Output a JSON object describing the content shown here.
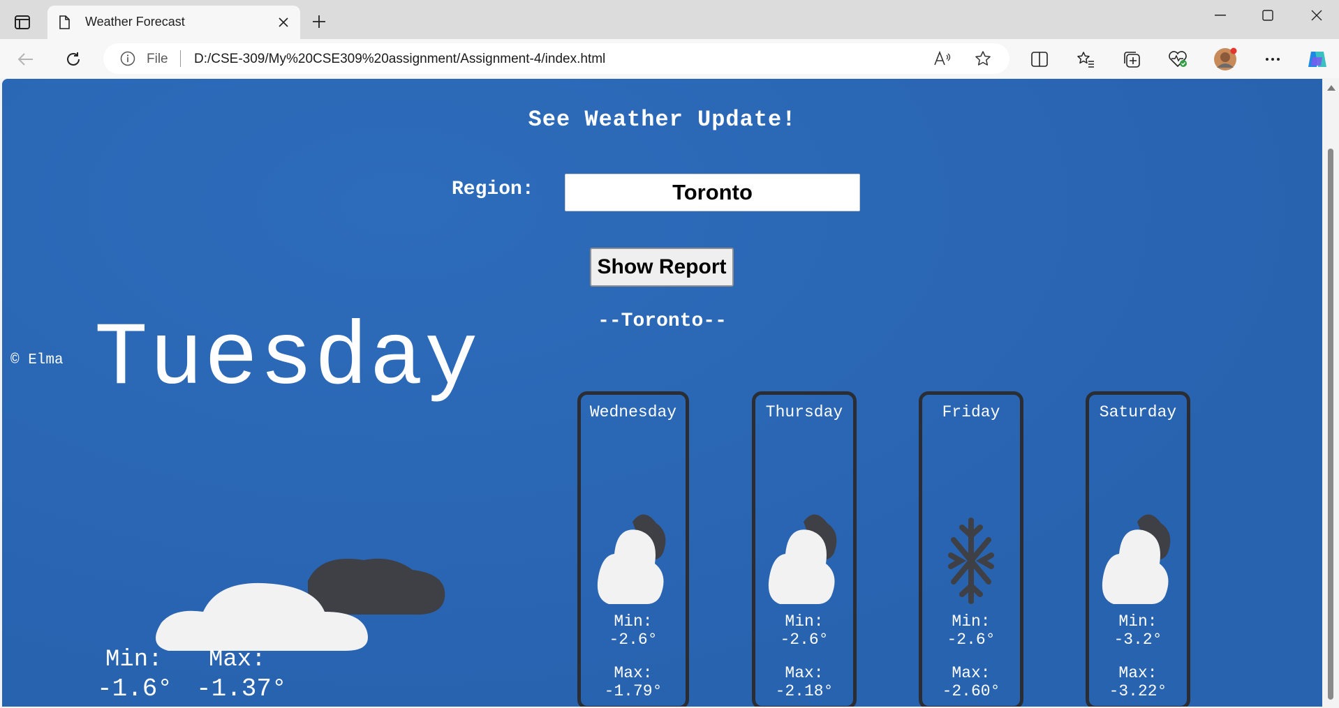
{
  "browser": {
    "tab_title": "Weather Forecast",
    "omnibox_scheme": "File",
    "url": "D:/CSE-309/My%20CSE309%20assignment/Assignment-4/index.html"
  },
  "page": {
    "heading": "See Weather Update!",
    "region_label": "Region:",
    "region_value": "Toronto",
    "button_label": "Show Report",
    "city_label": "--Toronto--",
    "copyright": "© Elma"
  },
  "today": {
    "name": "Tuesday",
    "min_label": "Min:",
    "max_label": "Max:",
    "min_value": "-1.6°",
    "max_value": "-1.37°",
    "icon": "partly-cloudy-icon"
  },
  "forecast": [
    {
      "day": "Wednesday",
      "icon": "cloudy-icon",
      "min_label": "Min:",
      "min": "-2.6°",
      "max_label": "Max:",
      "max": "-1.79°"
    },
    {
      "day": "Thursday",
      "icon": "cloudy-icon",
      "min_label": "Min:",
      "min": "-2.6°",
      "max_label": "Max:",
      "max": "-2.18°"
    },
    {
      "day": "Friday",
      "icon": "snow-icon",
      "min_label": "Min:",
      "min": "-2.6°",
      "max_label": "Max:",
      "max": "-2.60°"
    },
    {
      "day": "Saturday",
      "icon": "cloudy-icon",
      "min_label": "Min:",
      "min": "-3.2°",
      "max_label": "Max:",
      "max": "-3.22°"
    }
  ],
  "colors": {
    "page_background": "#2b68b6",
    "card_border": "#2a2d33",
    "text": "#ffffff"
  }
}
